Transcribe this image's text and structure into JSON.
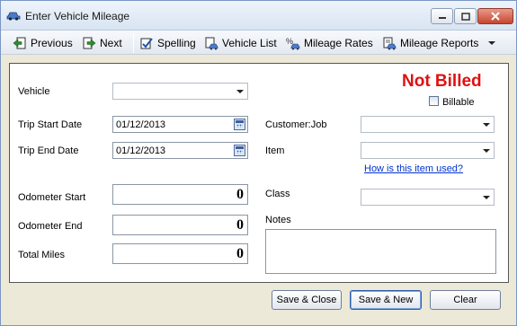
{
  "window": {
    "title": "Enter Vehicle Mileage"
  },
  "toolbar": {
    "previous_label": "Previous",
    "next_label": "Next",
    "spelling_label": "Spelling",
    "vehicle_list_label": "Vehicle List",
    "mileage_rates_label": "Mileage Rates",
    "mileage_reports_label": "Mileage Reports"
  },
  "form": {
    "vehicle_label": "Vehicle",
    "vehicle_value": "",
    "trip_start_label": "Trip Start Date",
    "trip_start_value": "01/12/2013",
    "trip_end_label": "Trip End Date",
    "trip_end_value": "01/12/2013",
    "odometer_start_label": "Odometer Start",
    "odometer_start_value": "0",
    "odometer_end_label": "Odometer End",
    "odometer_end_value": "0",
    "total_miles_label": "Total Miles",
    "total_miles_value": "0",
    "status": "Not Billed",
    "billable_label": "Billable",
    "billable_checked": false,
    "customer_job_label": "Customer:Job",
    "customer_job_value": "",
    "item_label": "Item",
    "item_value": "",
    "item_help_link": "How is this item used?",
    "class_label": "Class",
    "class_value": "",
    "notes_label": "Notes",
    "notes_value": ""
  },
  "buttons": {
    "save_close": "Save & Close",
    "save_new": "Save & New",
    "clear": "Clear"
  },
  "colors": {
    "status_red": "#e01010",
    "link_blue": "#0033cc"
  }
}
